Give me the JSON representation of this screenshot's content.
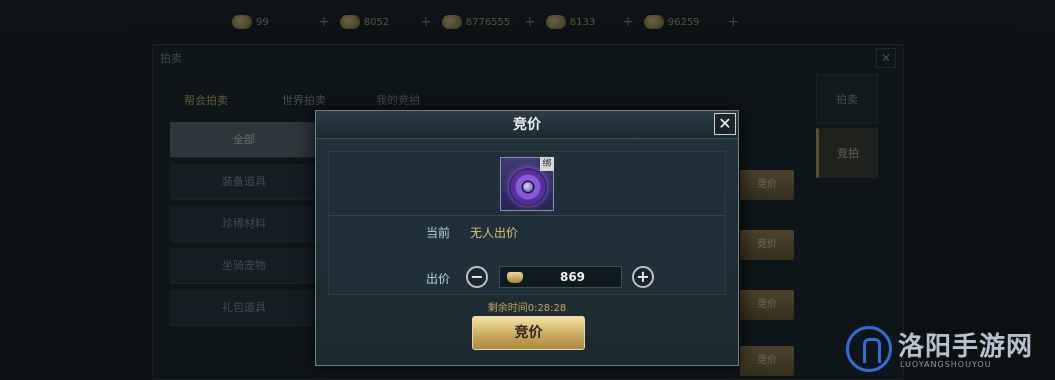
{
  "background": {
    "currencies": [
      {
        "amount": "99"
      },
      {
        "amount": "8052"
      },
      {
        "amount": "8776555"
      },
      {
        "amount": "8133"
      },
      {
        "amount": "96259"
      }
    ],
    "window_title": "拍卖",
    "tabs": [
      "帮会拍卖",
      "世界拍卖",
      "我的竞拍"
    ],
    "nav_items": [
      "全部",
      "装备道具",
      "珍稀材料",
      "坐骑宠物",
      "礼包道具"
    ],
    "row_buttons": [
      "竞价",
      "竞价",
      "竞价",
      "竞价"
    ],
    "side_tabs": [
      "拍卖",
      "竞拍"
    ]
  },
  "dialog": {
    "title": "竞价",
    "item": {
      "icon": "purple-orb-icon",
      "bind_tag": "绑"
    },
    "current_label": "当前",
    "current_value": "无人出价",
    "bid_label": "出价",
    "bid_amount": "869",
    "timer": "剩余时间0:28:28",
    "bid_button": "竞价"
  },
  "watermark": {
    "title": "洛阳手游网",
    "subtitle": "LUOYANGSHOUYOU"
  },
  "colors": {
    "accent_gold": "#c7a65c",
    "current_value": "#d9c27a",
    "dialog_bg": "#1c2a31"
  }
}
